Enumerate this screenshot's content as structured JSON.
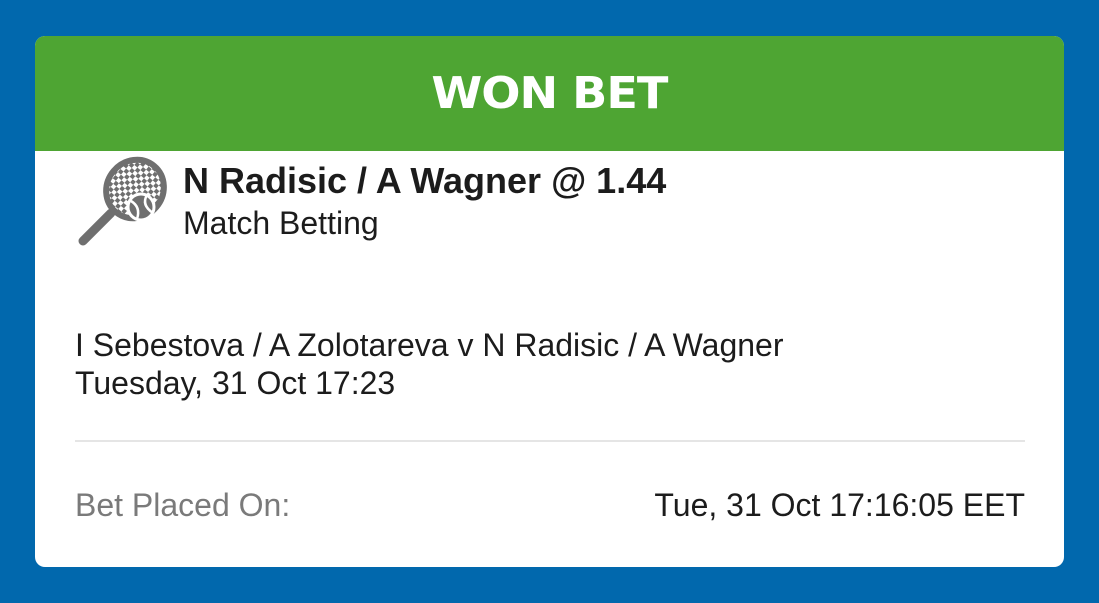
{
  "banner": {
    "title": "WON BET"
  },
  "selection": {
    "icon": "tennis-racket-icon",
    "title": "N Radisic / A Wagner @ 1.44",
    "market": "Match Betting"
  },
  "event": {
    "name": "I Sebestova / A Zolotareva v N Radisic / A Wagner",
    "datetime": "Tuesday, 31 Oct 17:23"
  },
  "placed": {
    "label": "Bet Placed On:",
    "value": "Tue, 31 Oct 17:16:05 EET"
  },
  "colors": {
    "background": "#0168ad",
    "banner": "#4ea533",
    "card": "#ffffff",
    "text": "#1c1c1c",
    "muted": "#7a7a7a"
  }
}
